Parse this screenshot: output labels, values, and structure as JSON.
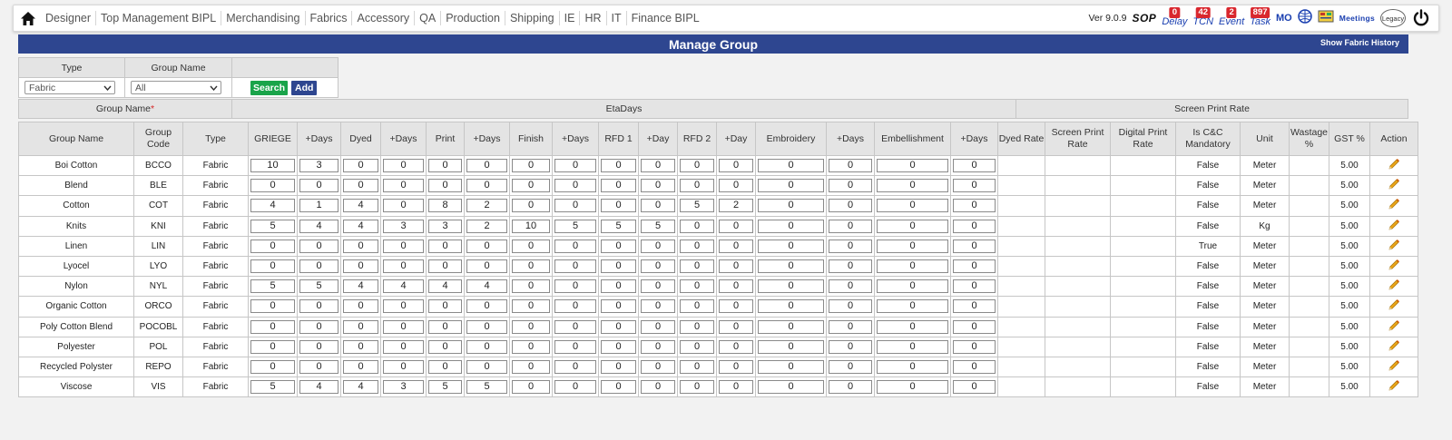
{
  "nav": {
    "menu": [
      "Designer",
      "Top Management BIPL",
      "Merchandising",
      "Fabrics",
      "Accessory",
      "QA",
      "Production",
      "Shipping",
      "IE",
      "HR",
      "IT",
      "Finance BIPL"
    ],
    "version": "Ver 9.0.9",
    "sop": "SOP",
    "quick": [
      {
        "label": "Delay",
        "badge": "0"
      },
      {
        "label": "TCN",
        "badge": "42"
      },
      {
        "label": "Event",
        "badge": "2"
      },
      {
        "label": "Task",
        "badge": "897"
      }
    ],
    "mo": "MO",
    "meetings": "Meetings",
    "legacy": "Legacy"
  },
  "title": "Manage Group",
  "history_link": "Show Fabric History",
  "filter": {
    "type_label": "Type",
    "group_name_label": "Group Name",
    "type_value": "Fabric",
    "group_value": "All",
    "search": "Search",
    "add": "Add"
  },
  "groups": {
    "group_name": "Group Name",
    "req": "*",
    "eta": "EtaDays",
    "screen": "Screen Print Rate"
  },
  "columns": [
    "Group Name",
    "Group Code",
    "Type",
    "GRIEGE",
    "+Days",
    "Dyed",
    "+Days",
    "Print",
    "+Days",
    "Finish",
    "+Days",
    "RFD 1",
    "+Day",
    "RFD 2",
    "+Day",
    "Embroidery",
    "+Days",
    "Embellishment",
    "+Days",
    "Dyed Rate",
    "Screen Print Rate",
    "Digital Print Rate",
    "Is C&C Mandatory",
    "Unit",
    "Wastage %",
    "GST %",
    "Action"
  ],
  "rows": [
    {
      "name": "Boi Cotton",
      "code": "BCCO",
      "type": "Fabric",
      "vals": [
        "10",
        "3",
        "0",
        "0",
        "0",
        "0",
        "0",
        "0",
        "0",
        "0",
        "0",
        "0",
        "0",
        "0",
        "0",
        "0"
      ],
      "cc": "False",
      "unit": "Meter",
      "gst": "5.00"
    },
    {
      "name": "Blend",
      "code": "BLE",
      "type": "Fabric",
      "vals": [
        "0",
        "0",
        "0",
        "0",
        "0",
        "0",
        "0",
        "0",
        "0",
        "0",
        "0",
        "0",
        "0",
        "0",
        "0",
        "0"
      ],
      "cc": "False",
      "unit": "Meter",
      "gst": "5.00"
    },
    {
      "name": "Cotton",
      "code": "COT",
      "type": "Fabric",
      "vals": [
        "4",
        "1",
        "4",
        "0",
        "8",
        "2",
        "0",
        "0",
        "0",
        "0",
        "5",
        "2",
        "0",
        "0",
        "0",
        "0"
      ],
      "cc": "False",
      "unit": "Meter",
      "gst": "5.00"
    },
    {
      "name": "Knits",
      "code": "KNI",
      "type": "Fabric",
      "vals": [
        "5",
        "4",
        "4",
        "3",
        "3",
        "2",
        "10",
        "5",
        "5",
        "5",
        "0",
        "0",
        "0",
        "0",
        "0",
        "0"
      ],
      "cc": "False",
      "unit": "Kg",
      "gst": "5.00"
    },
    {
      "name": "Linen",
      "code": "LIN",
      "type": "Fabric",
      "vals": [
        "0",
        "0",
        "0",
        "0",
        "0",
        "0",
        "0",
        "0",
        "0",
        "0",
        "0",
        "0",
        "0",
        "0",
        "0",
        "0"
      ],
      "cc": "True",
      "unit": "Meter",
      "gst": "5.00"
    },
    {
      "name": "Lyocel",
      "code": "LYO",
      "type": "Fabric",
      "vals": [
        "0",
        "0",
        "0",
        "0",
        "0",
        "0",
        "0",
        "0",
        "0",
        "0",
        "0",
        "0",
        "0",
        "0",
        "0",
        "0"
      ],
      "cc": "False",
      "unit": "Meter",
      "gst": "5.00"
    },
    {
      "name": "Nylon",
      "code": "NYL",
      "type": "Fabric",
      "vals": [
        "5",
        "5",
        "4",
        "4",
        "4",
        "4",
        "0",
        "0",
        "0",
        "0",
        "0",
        "0",
        "0",
        "0",
        "0",
        "0"
      ],
      "cc": "False",
      "unit": "Meter",
      "gst": "5.00"
    },
    {
      "name": "Organic Cotton",
      "code": "ORCO",
      "type": "Fabric",
      "vals": [
        "0",
        "0",
        "0",
        "0",
        "0",
        "0",
        "0",
        "0",
        "0",
        "0",
        "0",
        "0",
        "0",
        "0",
        "0",
        "0"
      ],
      "cc": "False",
      "unit": "Meter",
      "gst": "5.00"
    },
    {
      "name": "Poly Cotton Blend",
      "code": "POCOBL",
      "type": "Fabric",
      "vals": [
        "0",
        "0",
        "0",
        "0",
        "0",
        "0",
        "0",
        "0",
        "0",
        "0",
        "0",
        "0",
        "0",
        "0",
        "0",
        "0"
      ],
      "cc": "False",
      "unit": "Meter",
      "gst": "5.00"
    },
    {
      "name": "Polyester",
      "code": "POL",
      "type": "Fabric",
      "vals": [
        "0",
        "0",
        "0",
        "0",
        "0",
        "0",
        "0",
        "0",
        "0",
        "0",
        "0",
        "0",
        "0",
        "0",
        "0",
        "0"
      ],
      "cc": "False",
      "unit": "Meter",
      "gst": "5.00"
    },
    {
      "name": "Recycled Polyster",
      "code": "REPO",
      "type": "Fabric",
      "vals": [
        "0",
        "0",
        "0",
        "0",
        "0",
        "0",
        "0",
        "0",
        "0",
        "0",
        "0",
        "0",
        "0",
        "0",
        "0",
        "0"
      ],
      "cc": "False",
      "unit": "Meter",
      "gst": "5.00"
    },
    {
      "name": "Viscose",
      "code": "VIS",
      "type": "Fabric",
      "vals": [
        "5",
        "4",
        "4",
        "3",
        "5",
        "5",
        "0",
        "0",
        "0",
        "0",
        "0",
        "0",
        "0",
        "0",
        "0",
        "0"
      ],
      "cc": "False",
      "unit": "Meter",
      "gst": "5.00"
    }
  ],
  "colors": {
    "brand": "#2e4690",
    "search": "#1aa44a",
    "badge": "#d9272e",
    "pencil": "#e8a317"
  }
}
